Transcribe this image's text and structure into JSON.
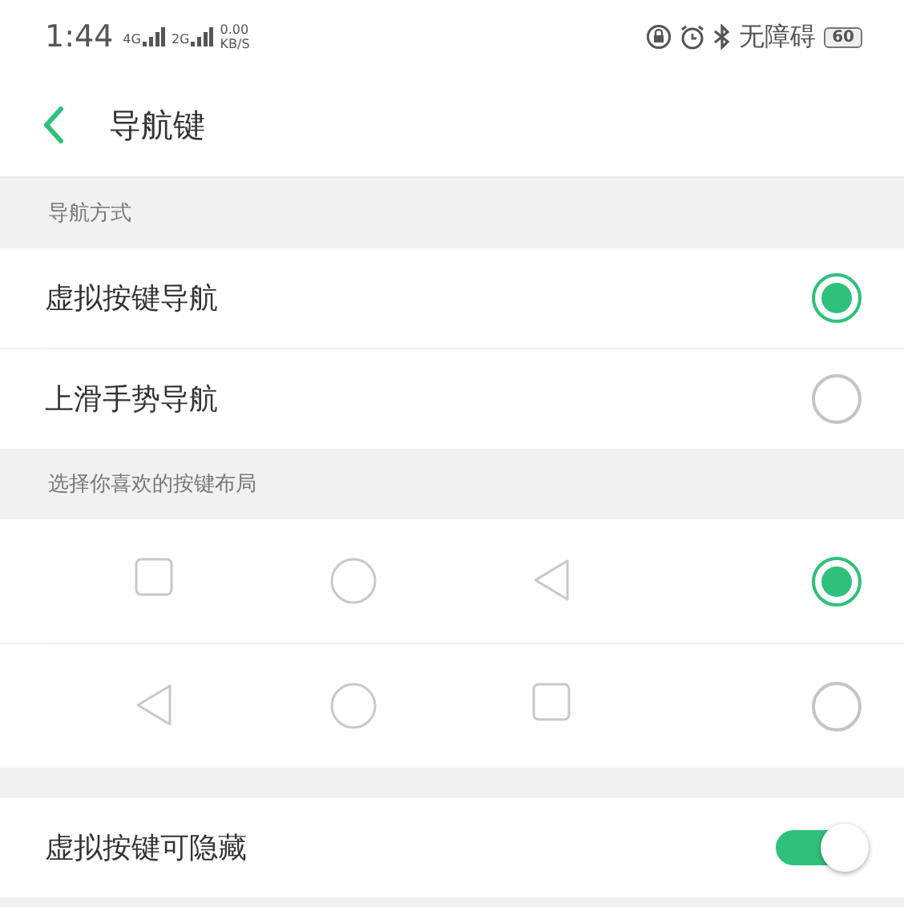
{
  "status_bar": {
    "time": "1:44",
    "net1": "4G",
    "net2": "2G",
    "speed": "0.00",
    "speed_unit": "KB/S",
    "accessibility": "无障碍",
    "battery": "60"
  },
  "header": {
    "title": "导航键"
  },
  "nav_mode": {
    "title": "导航方式",
    "options": [
      {
        "label": "虚拟按键导航",
        "selected": true
      },
      {
        "label": "上滑手势导航",
        "selected": false
      }
    ]
  },
  "layout": {
    "title": "选择你喜欢的按键布局",
    "options": [
      {
        "keys": [
          {
            "kind": "square"
          },
          {
            "kind": "circle"
          },
          {
            "kind": "triangle"
          }
        ],
        "selected": true
      },
      {
        "keys": [
          {
            "kind": "triangle"
          },
          {
            "kind": "circle"
          },
          {
            "kind": "square"
          }
        ],
        "selected": false
      }
    ]
  },
  "hide_keys": {
    "label": "虚拟按键可隐藏",
    "on": true
  }
}
